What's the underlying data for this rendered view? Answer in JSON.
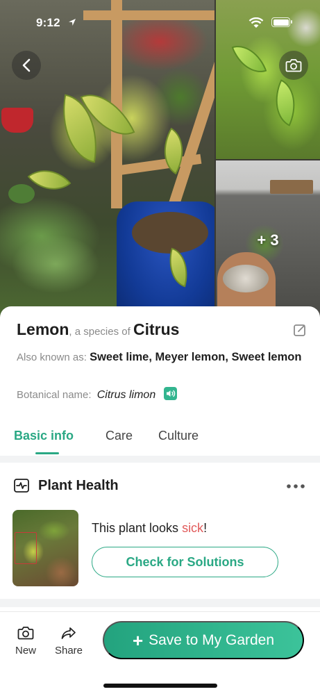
{
  "status_bar": {
    "time": "9:12"
  },
  "gallery": {
    "more_photos_label": "+ 3"
  },
  "plant": {
    "common_name": "Lemon",
    "species_connector": ", a species of ",
    "genus": "Citrus",
    "aka_label": "Also known as: ",
    "aka_value": "Sweet lime, Meyer lemon, Sweet lemon",
    "botanical_label": "Botanical name:",
    "botanical_value": "Citrus limon"
  },
  "tabs": [
    {
      "label": "Basic info",
      "active": true
    },
    {
      "label": "Care",
      "active": false
    },
    {
      "label": "Culture",
      "active": false
    }
  ],
  "health": {
    "title": "Plant Health",
    "message_prefix": "This plant looks ",
    "status_word": "sick",
    "message_suffix": "!",
    "button_label": "Check for Solutions"
  },
  "bottom_bar": {
    "new_label": "New",
    "share_label": "Share",
    "save_label": "Save to My Garden"
  },
  "icons": {
    "back": "chevron-left-icon",
    "camera": "camera-icon",
    "edit": "edit-icon",
    "speaker": "speaker-icon",
    "health": "pulse-icon",
    "more": "more-dots-icon",
    "share": "share-arrow-icon"
  },
  "colors": {
    "accent": "#2aa884",
    "alert": "#e15a5a",
    "text_primary": "#1e1e1e",
    "text_muted": "#8a8a8a"
  }
}
